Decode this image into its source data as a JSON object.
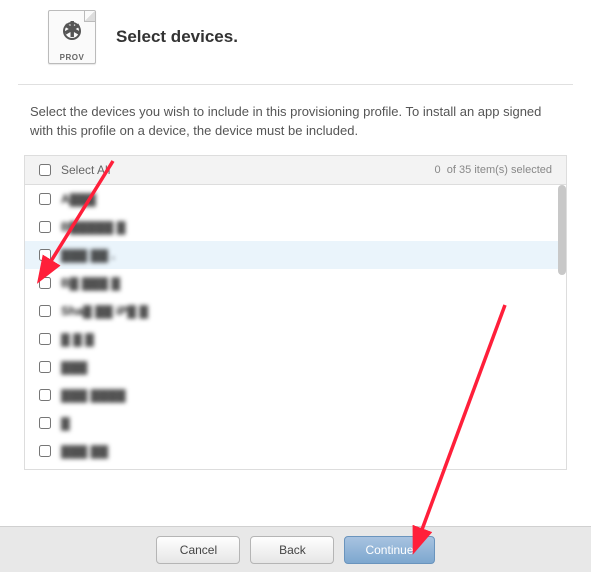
{
  "header": {
    "prov_label": "PROV",
    "title": "Select devices."
  },
  "instruction": "Select the devices you wish to include in this provisioning profile. To install an app signed with this profile on a device, the device must be included.",
  "list": {
    "select_all_label": "Select All",
    "selected_count": "0",
    "total_count": "35",
    "count_suffix": "item(s) selected",
    "of_label": "of",
    "rows": [
      {
        "label": "A▓▓▓",
        "highlight": false
      },
      {
        "label": "B▓▓▓▓▓ ▓",
        "highlight": false
      },
      {
        "label": "▓▓▓ ▓▓ .",
        "highlight": true
      },
      {
        "label": "B▓ ▓▓▓ ▓",
        "highlight": false
      },
      {
        "label": "Sha▓ ▓▓ iP▓ ▓",
        "highlight": false
      },
      {
        "label": "▓ ▓ ▓",
        "highlight": false
      },
      {
        "label": "▓▓▓",
        "highlight": false
      },
      {
        "label": "▓▓▓ ▓▓▓▓",
        "highlight": false
      },
      {
        "label": "▓",
        "highlight": false
      },
      {
        "label": "▓▓▓ ▓▓",
        "highlight": false
      }
    ]
  },
  "footer": {
    "cancel": "Cancel",
    "back": "Back",
    "continue": "Continue"
  }
}
